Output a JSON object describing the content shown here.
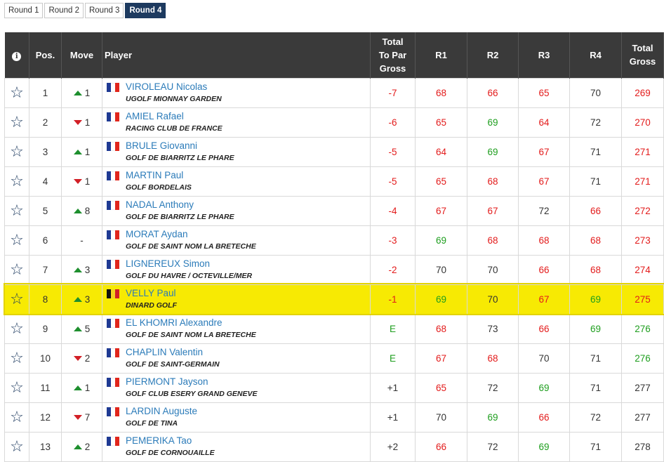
{
  "tabs": [
    {
      "label": "Round 1",
      "active": false
    },
    {
      "label": "Round 2",
      "active": false
    },
    {
      "label": "Round 3",
      "active": false
    },
    {
      "label": "Round 4",
      "active": true
    }
  ],
  "headers": {
    "info": "i",
    "pos": "Pos.",
    "move": "Move",
    "player": "Player",
    "to_par": "Total To Par Gross",
    "r1": "R1",
    "r2": "R2",
    "r3": "R3",
    "r4": "R4",
    "total": "Total Gross"
  },
  "colors": {
    "under": "#e31b1b",
    "even": "#1e9e1e",
    "over": "#333333",
    "highlight": "#f7ea03",
    "link": "#2b7bb9"
  },
  "rows": [
    {
      "pos": "1",
      "dir": "up",
      "move": "1",
      "flag": "fr",
      "name": "VIROLEAU Nicolas",
      "club": "UGOLF MIONNAY GARDEN",
      "par": "-7",
      "r1": "68",
      "r2": "66",
      "r3": "65",
      "r4": "70",
      "total": "269",
      "c": [
        "red",
        "red",
        "red",
        "red",
        "black",
        "red"
      ]
    },
    {
      "pos": "2",
      "dir": "down",
      "move": "1",
      "flag": "fr",
      "name": "AMIEL Rafael",
      "club": "RACING CLUB DE FRANCE",
      "par": "-6",
      "r1": "65",
      "r2": "69",
      "r3": "64",
      "r4": "72",
      "total": "270",
      "c": [
        "red",
        "red",
        "green",
        "red",
        "black",
        "red"
      ]
    },
    {
      "pos": "3",
      "dir": "up",
      "move": "1",
      "flag": "fr",
      "name": "BRULE Giovanni",
      "club": "GOLF DE BIARRITZ LE PHARE",
      "par": "-5",
      "r1": "64",
      "r2": "69",
      "r3": "67",
      "r4": "71",
      "total": "271",
      "c": [
        "red",
        "red",
        "green",
        "red",
        "black",
        "red"
      ]
    },
    {
      "pos": "4",
      "dir": "down",
      "move": "1",
      "flag": "fr",
      "name": "MARTIN Paul",
      "club": "GOLF BORDELAIS",
      "par": "-5",
      "r1": "65",
      "r2": "68",
      "r3": "67",
      "r4": "71",
      "total": "271",
      "c": [
        "red",
        "red",
        "red",
        "red",
        "black",
        "red"
      ]
    },
    {
      "pos": "5",
      "dir": "up",
      "move": "8",
      "flag": "fr",
      "name": "NADAL Anthony",
      "club": "GOLF DE BIARRITZ LE PHARE",
      "par": "-4",
      "r1": "67",
      "r2": "67",
      "r3": "72",
      "r4": "66",
      "total": "272",
      "c": [
        "red",
        "red",
        "red",
        "black",
        "red",
        "red"
      ]
    },
    {
      "pos": "6",
      "dir": "none",
      "move": "-",
      "flag": "fr",
      "name": "MORAT Aydan",
      "club": "GOLF DE SAINT NOM LA BRETECHE",
      "par": "-3",
      "r1": "69",
      "r2": "68",
      "r3": "68",
      "r4": "68",
      "total": "273",
      "c": [
        "red",
        "green",
        "red",
        "red",
        "red",
        "red"
      ]
    },
    {
      "pos": "7",
      "dir": "up",
      "move": "3",
      "flag": "fr",
      "name": "LIGNEREUX Simon",
      "club": "GOLF DU HAVRE / OCTEVILLE/MER",
      "par": "-2",
      "r1": "70",
      "r2": "70",
      "r3": "66",
      "r4": "68",
      "total": "274",
      "c": [
        "red",
        "black",
        "black",
        "red",
        "red",
        "red"
      ]
    },
    {
      "pos": "8",
      "dir": "up",
      "move": "3",
      "flag": "be",
      "name": "VELLY Paul",
      "club": "DINARD GOLF",
      "par": "-1",
      "r1": "69",
      "r2": "70",
      "r3": "67",
      "r4": "69",
      "total": "275",
      "c": [
        "red",
        "green",
        "black",
        "red",
        "green",
        "red"
      ],
      "highlight": true
    },
    {
      "pos": "9",
      "dir": "up",
      "move": "5",
      "flag": "fr",
      "name": "EL KHOMRI Alexandre",
      "club": "GOLF DE SAINT NOM LA BRETECHE",
      "par": "E",
      "r1": "68",
      "r2": "73",
      "r3": "66",
      "r4": "69",
      "total": "276",
      "c": [
        "green",
        "red",
        "black",
        "red",
        "green",
        "green"
      ]
    },
    {
      "pos": "10",
      "dir": "down",
      "move": "2",
      "flag": "fr",
      "name": "CHAPLIN Valentin",
      "club": "GOLF DE SAINT-GERMAIN",
      "par": "E",
      "r1": "67",
      "r2": "68",
      "r3": "70",
      "r4": "71",
      "total": "276",
      "c": [
        "green",
        "red",
        "red",
        "black",
        "black",
        "green"
      ]
    },
    {
      "pos": "11",
      "dir": "up",
      "move": "1",
      "flag": "fr",
      "name": "PIERMONT Jayson",
      "club": "GOLF CLUB ESERY GRAND GENEVE",
      "par": "+1",
      "r1": "65",
      "r2": "72",
      "r3": "69",
      "r4": "71",
      "total": "277",
      "c": [
        "black",
        "red",
        "black",
        "green",
        "black",
        "black"
      ]
    },
    {
      "pos": "12",
      "dir": "down",
      "move": "7",
      "flag": "fr",
      "name": "LARDIN Auguste",
      "club": "GOLF DE TINA",
      "par": "+1",
      "r1": "70",
      "r2": "69",
      "r3": "66",
      "r4": "72",
      "total": "277",
      "c": [
        "black",
        "black",
        "green",
        "red",
        "black",
        "black"
      ]
    },
    {
      "pos": "13",
      "dir": "up",
      "move": "2",
      "flag": "fr",
      "name": "PEMERIKA Tao",
      "club": "GOLF DE CORNOUAILLE",
      "par": "+2",
      "r1": "66",
      "r2": "72",
      "r3": "69",
      "r4": "71",
      "total": "278",
      "c": [
        "black",
        "red",
        "black",
        "green",
        "black",
        "black"
      ]
    }
  ]
}
